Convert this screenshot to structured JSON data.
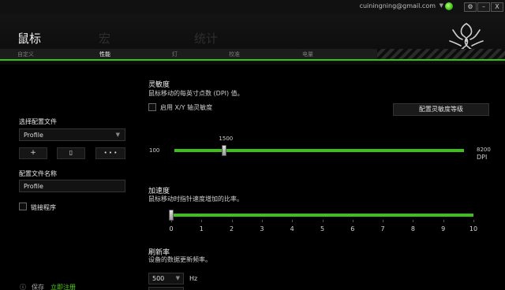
{
  "titlebar": {
    "email": "cuiningning@gmail.com",
    "caret": "▼",
    "gear": "⚙",
    "minimize": "–",
    "close": "X"
  },
  "header": {
    "tabs": [
      "鼠标",
      "宏",
      "统计"
    ],
    "logo_icon": "razer-logo-icon"
  },
  "subtabs": [
    "自定义",
    "性能",
    "灯",
    "校准",
    "电量"
  ],
  "left": {
    "profile_label": "选择配置文件",
    "profile_value": "Profile",
    "profile_caret": "▼",
    "add_btn": "+",
    "mid_btn": "▯",
    "more_btn": "• • •",
    "name_label": "配置文件名称",
    "name_value": "Profile",
    "link_label": "链接程序",
    "footer_icon": "ⓘ",
    "footer_text": "保存",
    "footer_link": "立即注册"
  },
  "sensitivity": {
    "title": "灵敏度",
    "desc": "鼠标移动的每英寸点数 (DPI) 值。",
    "xy_label": "启用 X/Y 轴灵敏度",
    "config_button": "配置灵敏度等级",
    "min": "100",
    "max": "8200",
    "value": "1500",
    "unit": "DPI",
    "range": [
      100,
      8200
    ],
    "current": 1500
  },
  "acceleration": {
    "title": "加速度",
    "desc": "鼠标移动时指针速度增加的比率。",
    "ticks": [
      "0",
      "1",
      "2",
      "3",
      "4",
      "5",
      "6",
      "7",
      "8",
      "9",
      "10"
    ],
    "current": 0
  },
  "polling": {
    "title": "刷新率",
    "desc": "设备的数据更新频率。",
    "value": "500",
    "caret": "▼",
    "unit": "Hz"
  },
  "colors": {
    "accent": "#38c20c",
    "background": "#000000"
  }
}
